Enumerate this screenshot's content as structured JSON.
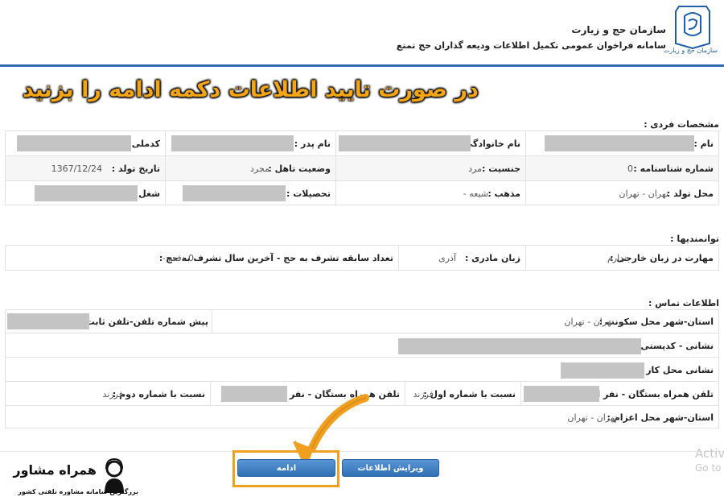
{
  "header": {
    "org_name": "سازمان حج و زیارت",
    "system_name": "سامانه فراخوان عمومی تکمیل اطلاعات ودیعه گذاران حج تمتع",
    "logo_caption": "سازمان حج و زیارت"
  },
  "overlay_title": "در صورت تایید اطلاعات دکمه ادامه را بزنید",
  "personal": {
    "title": "مشخصات فردی :",
    "rows": [
      [
        {
          "label": "نام :",
          "value": ""
        },
        {
          "label": "نام خانوادگی :",
          "value": ""
        },
        {
          "label": "نام پدر :",
          "value": ""
        },
        {
          "label": "کدملی :",
          "value": ""
        }
      ],
      [
        {
          "label": "شماره شناسنامه :",
          "value": "0"
        },
        {
          "label": "جنسیت :",
          "value": "مرد"
        },
        {
          "label": "وضعیت تاهل :",
          "value": "مجرد"
        },
        {
          "label": "تاریخ تولد :",
          "value": "1367/12/24"
        }
      ],
      [
        {
          "label": "محل تولد :",
          "value": "تهران - تهران"
        },
        {
          "label": "مذهب :",
          "value": "شیعه -"
        },
        {
          "label": "تحصیلات :",
          "value": ""
        },
        {
          "label": "شغل :",
          "value": ""
        }
      ]
    ]
  },
  "abilities": {
    "title": "توانمندیها :",
    "items": [
      {
        "label": "مهارت در زبان خارجی :",
        "value": "ندارم"
      },
      {
        "label": "زبان مادری :",
        "value": "آذری"
      },
      {
        "label": "تعداد سابقه تشرف به حج - آخرین سال تشرف به حج :",
        "value": "0 دفعه -"
      }
    ]
  },
  "contact": {
    "title": "اطلاعات تماس :",
    "residence_label": "استان-شهر محل سکونت :",
    "residence_value": "تهران - تهران",
    "phone_prefix_label": "پیش شماره تلفن-تلفن ثابت :",
    "address_label": "نشانی - کدپستی :",
    "work_address_label": "نشانی محل کار :",
    "companion1_label": "تلفن همراه بستگان - نفر اول :",
    "relation1_label": "نسبت با شماره اول :",
    "relation1_value": "فرزند",
    "companion2_label": "تلفن همراه بستگان - نفر دوم :",
    "relation2_label": "نسبت با شماره دوم :",
    "relation2_value": "فرزند",
    "dispatch_label": "استان-شهر محل اعزام :",
    "dispatch_value": "تهران - تهران"
  },
  "buttons": {
    "continue_label": "ادامه",
    "edit_label": "ویرایش اطلاعات"
  },
  "watermark": {
    "brand": "همراه مشاور",
    "tagline": "بزرگترین سامانه مشاوره تلفنی کشور"
  },
  "windows_notice": {
    "line1": "Activ",
    "line2": "Go to"
  },
  "colors": {
    "header_line": "#2e6db4",
    "overlay_text": "#f3a516",
    "highlight": "#f0a020",
    "button": "#3a7bc2",
    "redaction": "#c4c4c4"
  }
}
